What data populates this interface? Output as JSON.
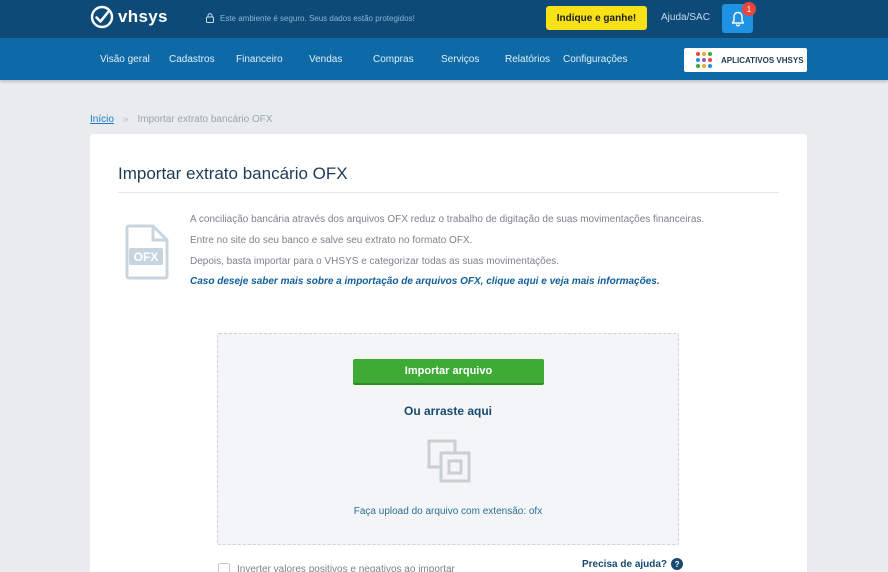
{
  "header": {
    "logo_text": "vhsys",
    "secure_text": "Este ambiente é seguro. Seus dados estão protegidos!",
    "indique_label": "Indique e ganhe!",
    "ajuda_label": "Ajuda/SAC",
    "notification_count": "1"
  },
  "nav": {
    "items": [
      {
        "label": "Visão geral"
      },
      {
        "label": "Cadastros"
      },
      {
        "label": "Financeiro"
      },
      {
        "label": "Vendas"
      },
      {
        "label": "Compras"
      },
      {
        "label": "Serviços"
      },
      {
        "label": "Relatórios"
      },
      {
        "label": "Configurações"
      }
    ],
    "apps_label": "APLICATIVOS VHSYS",
    "apps_colors": [
      "#e8453c",
      "#f5a623",
      "#3eab36",
      "#1f92e3",
      "#9b59b6",
      "#e8453c",
      "#3eab36",
      "#f5a623",
      "#1f92e3"
    ]
  },
  "breadcrumb": {
    "home": "Início",
    "separator": "»",
    "current": "Importar extrato bancário OFX"
  },
  "page": {
    "title": "Importar extrato bancário OFX",
    "icon_label": "OFX",
    "description": [
      "A conciliação bancária através dos arquivos OFX reduz o trabalho de digitação de suas movimentações financeiras.",
      "Entre no site do seu banco e salve seu extrato no formato OFX.",
      "Depois, basta importar para o VHSYS e categorizar todas as suas movimentações."
    ],
    "info_link": "Caso deseje saber mais sobre a importação de arquivos OFX, clique aqui e veja mais informações."
  },
  "upload": {
    "button_label": "Importar arquivo",
    "drag_text": "Ou arraste aqui",
    "extension_text": "Faça upload do arquivo com extensão: ofx"
  },
  "options": {
    "invert_label": "Inverter valores positivos e negativos ao importar",
    "invert_checked": false,
    "help_label": "Precisa de ajuda?",
    "help_icon": "?"
  },
  "colors": {
    "topbar": "#0d4a78",
    "navbar": "#0e6aa6",
    "accent_yellow": "#f8e117",
    "import_green": "#3eab36",
    "bell_blue": "#1f92e3"
  }
}
